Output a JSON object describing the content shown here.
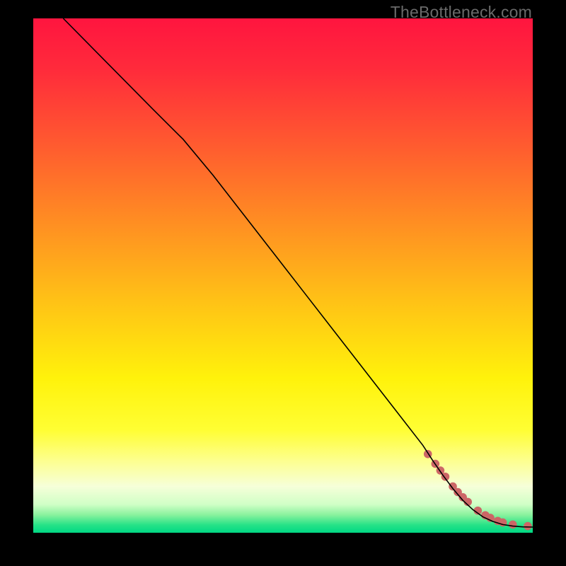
{
  "watermark": "TheBottleneck.com",
  "chart_data": {
    "type": "line",
    "title": "",
    "xlabel": "",
    "ylabel": "",
    "xlim": [
      0,
      100
    ],
    "ylim": [
      0,
      100
    ],
    "background_gradient": {
      "stops": [
        {
          "pos": 0.0,
          "color": "#ff153f"
        },
        {
          "pos": 0.1,
          "color": "#ff2b3b"
        },
        {
          "pos": 0.25,
          "color": "#ff5c2f"
        },
        {
          "pos": 0.4,
          "color": "#ff8f22"
        },
        {
          "pos": 0.55,
          "color": "#ffc216"
        },
        {
          "pos": 0.7,
          "color": "#fff20b"
        },
        {
          "pos": 0.8,
          "color": "#fffe33"
        },
        {
          "pos": 0.86,
          "color": "#fdff8f"
        },
        {
          "pos": 0.91,
          "color": "#f6ffd9"
        },
        {
          "pos": 0.945,
          "color": "#d0ffc6"
        },
        {
          "pos": 0.965,
          "color": "#8af29e"
        },
        {
          "pos": 0.985,
          "color": "#26e287"
        },
        {
          "pos": 1.0,
          "color": "#00d884"
        }
      ]
    },
    "series": [
      {
        "name": "curve",
        "style": "line",
        "color": "#000000",
        "x": [
          6,
          12,
          18,
          24,
          30,
          36,
          42,
          48,
          54,
          60,
          66,
          72,
          78,
          80,
          82,
          84,
          86,
          88,
          90,
          92,
          94,
          96,
          98,
          100
        ],
        "y": [
          100,
          94.1,
          88.2,
          82.3,
          76.5,
          69.5,
          62.0,
          54.5,
          47.0,
          39.5,
          32.0,
          24.5,
          17.0,
          14.0,
          11.2,
          8.6,
          6.3,
          4.5,
          3.1,
          2.2,
          1.6,
          1.3,
          1.15,
          1.1
        ]
      },
      {
        "name": "points-near-minimum",
        "style": "scatter",
        "color": "#cc6666",
        "x": [
          79.0,
          80.5,
          81.5,
          82.5,
          84.0,
          85.0,
          86.0,
          87.0,
          89.0,
          90.5,
          91.5,
          93.0,
          94.0,
          96.0,
          99.0
        ],
        "y": [
          15.3,
          13.4,
          12.1,
          10.9,
          9.0,
          7.9,
          6.9,
          6.0,
          4.3,
          3.4,
          2.9,
          2.3,
          2.0,
          1.6,
          1.3
        ]
      }
    ]
  }
}
